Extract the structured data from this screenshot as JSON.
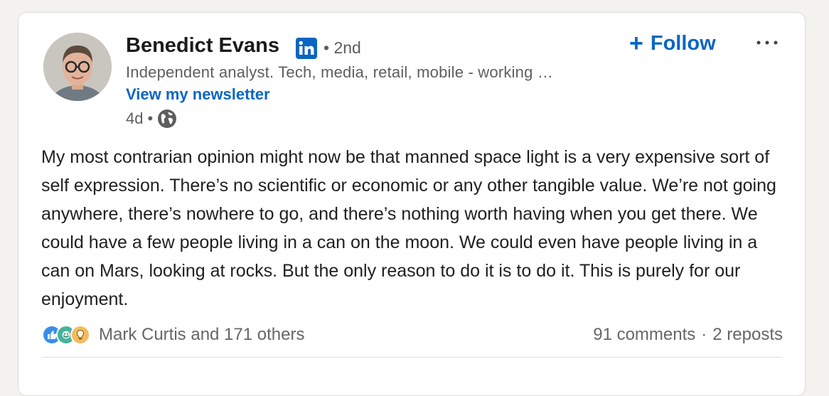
{
  "post": {
    "author": {
      "name": "Benedict Evans",
      "degree": "2nd",
      "headline": "Independent analyst. Tech, media, retail, mobile - working …",
      "newsletter_link": "View my newsletter",
      "time_ago": "4d",
      "visibility_icon": "globe-icon",
      "badge_icon": "linkedin-icon"
    },
    "follow_label": "Follow",
    "follow_icon": "plus-icon",
    "more_icon": "more-horizontal-icon",
    "body": "My most contrarian opinion might now be that manned space light is a very expensive sort of self expression. There’s no scientific or economic or any other tangible value. We’re not going anywhere, there’s nowhere to go, and there’s nothing worth having when you get there. We could have a few people living in a can on the moon. We could even have people living in a can on Mars, looking at rocks. But the only reason to do it is to do it. This is purely for our enjoyment.",
    "social": {
      "reaction_icons": [
        "like-icon",
        "celebrate-icon",
        "insightful-icon"
      ],
      "reactors_text": "Mark Curtis and 171 others",
      "comments": "91 comments",
      "reposts": "2 reposts"
    }
  },
  "colors": {
    "page_background": "#f4f2ee",
    "card_background": "#ffffff",
    "link_blue": "#0a66c2",
    "secondary_text": "#5e5e5e"
  }
}
